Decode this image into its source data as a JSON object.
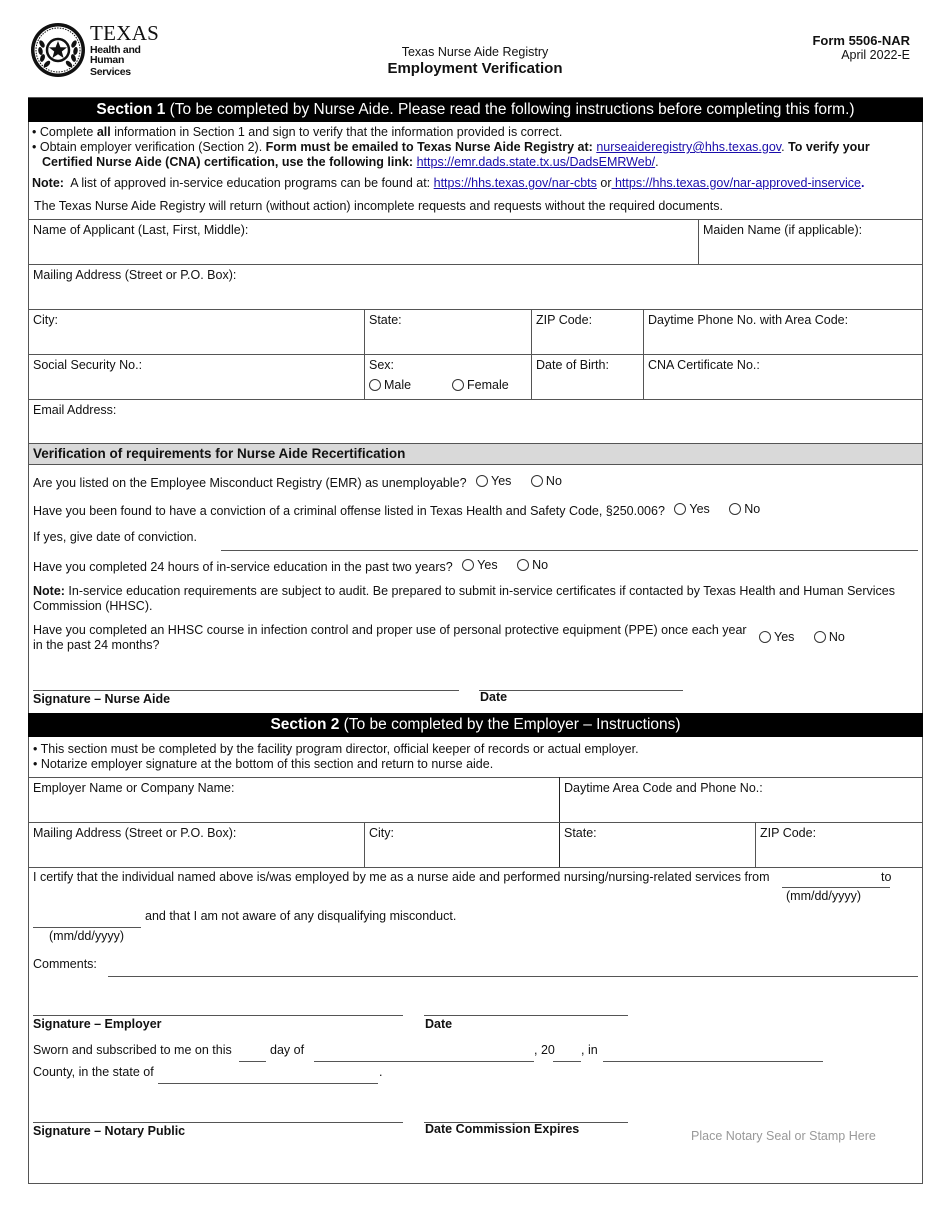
{
  "header": {
    "logo": {
      "wordmark": "TEXAS",
      "line2": "Health and Human",
      "line3": "Services",
      "icon": "texas-seal-star-icon"
    },
    "subtitle": "Texas Nurse Aide Registry",
    "title": "Employment Verification",
    "form_number": "Form 5506-NAR",
    "form_date": "April 2022-E"
  },
  "section1": {
    "bar_bold": "Section 1",
    "bar_rest": " (To be completed by Nurse Aide. Please read the following instructions before completing this form.)",
    "instructions": {
      "b1_pre": "• Complete ",
      "b1_bold": "all",
      "b1_post": " information in Section 1 and sign to verify that the information provided is correct.",
      "b2_pre": "• Obtain employer verification (Section 2). ",
      "b2_bold": "Form must be emailed to Texas Nurse Aide Registry at:",
      "b2_email": "nurseaideregistry@hhs.texas.gov",
      "b2_bold2": "To verify your",
      "b2_bold3": "Certified Nurse Aide (CNA) certification, use the following link:",
      "b2_link": "https://emr.dads.state.tx.us/DadsEMRWeb/",
      "note_label": "Note:",
      "note_text": "  A list of approved in-service education programs can be found at: ",
      "note_link1": "https://hhs.texas.gov/nar-cbts",
      "note_or": " or",
      "note_link2": " https://hhs.texas.gov/nar-approved-inservice",
      "return_text": "The Texas Nurse Aide Registry will return (without action) incomplete requests and requests without the required documents."
    },
    "fields": {
      "name": "Name of Applicant (Last, First, Middle):",
      "maiden": "Maiden Name (if applicable):",
      "mailing": "Mailing Address (Street or P.O. Box):",
      "city": "City:",
      "state": "State:",
      "zip": "ZIP Code:",
      "phone": "Daytime Phone No. with Area Code:",
      "ssn": "Social Security No.:",
      "sex": "Sex:",
      "sex_male": "Male",
      "sex_female": "Female",
      "dob": "Date of Birth:",
      "cna": "CNA Certificate No.:",
      "email": "Email Address:"
    },
    "verification": {
      "heading": "Verification of requirements for Nurse Aide Recertification",
      "q1": "Are you listed on the Employee Misconduct Registry (EMR) as unemployable?",
      "q2": "Have you been found to have a conviction of a criminal offense listed in Texas Health and Safety Code, §250.006?",
      "q2_followup": "If yes, give date of conviction.",
      "q3": "Have you completed 24 hours of in-service education in the past two years?",
      "note_label": "Note:",
      "note_text": " In-service education requirements are subject to audit. Be prepared to submit in-service certificates if contacted by Texas Health and Human Services Commission (HHSC).",
      "q4_line1": "Have you completed an HHSC course in infection control and proper use of personal protective equipment (PPE) once each year",
      "q4_line2": "in the past 24 months?",
      "yes": "Yes",
      "no": "No"
    },
    "signature_label": "Signature – Nurse Aide",
    "date_label": "Date"
  },
  "section2": {
    "bar_bold": "Section 2",
    "bar_rest": " (To be completed by the Employer – Instructions)",
    "b1": "• This section must be completed by the facility program director, official keeper of records or actual employer.",
    "b2": "• Notarize employer signature at the bottom of this section and return to nurse aide.",
    "fields": {
      "employer": "Employer Name or Company Name:",
      "phone": "Daytime Area Code and Phone No.:",
      "mailing": "Mailing Address (Street or P.O. Box):",
      "city": "City:",
      "state": "State:",
      "zip": "ZIP Code:"
    },
    "certify_text": "I certify that the individual named above is/was employed by me as a nurse aide and performed nursing/nursing-related services from",
    "to": "to",
    "date_format": "(mm/dd/yyyy)",
    "misconduct_text": "and that I am not aware of any disqualifying misconduct.",
    "comments": "Comments:",
    "sig_employer": "Signature – Employer",
    "date_label": "Date",
    "sworn_text": "Sworn and subscribed to me on this",
    "day_of": "day of",
    "comma_20": ", 20",
    "comma_in": ", in",
    "county_text": "County, in the state of",
    "period": ".",
    "sig_notary": "Signature – Notary Public",
    "commission": "Date Commission Expires",
    "seal": "Place Notary Seal or Stamp Here"
  }
}
